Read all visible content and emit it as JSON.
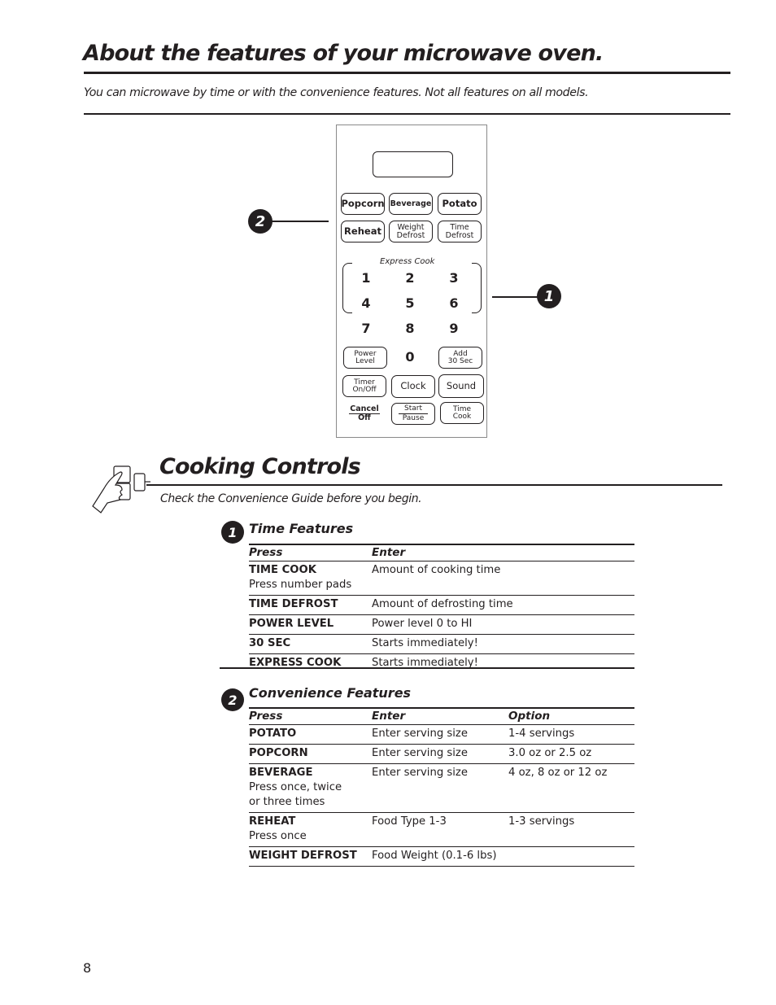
{
  "header": {
    "title": "About the features of your microwave oven.",
    "intro": "You can microwave by time or with the convenience features.  Not all features on all models."
  },
  "control_panel": {
    "row1": [
      "Popcorn",
      "Beverage",
      "Potato"
    ],
    "row2": [
      "Reheat",
      "Weight\nDefrost",
      "Time\nDefrost"
    ],
    "express_cook_label": "Express Cook",
    "numbers": [
      "1",
      "2",
      "3",
      "4",
      "5",
      "6",
      "7",
      "8",
      "9",
      "0"
    ],
    "power_level": "Power\nLevel",
    "add_30_sec": "Add\n30 Sec",
    "timer": "Timer\nOn/Off",
    "clock": "Clock",
    "sound": "Sound",
    "cancel_top": "Cancel",
    "cancel_bottom": "Off",
    "start_top": "Start",
    "start_bottom": "Pause",
    "time_cook": "Time\nCook",
    "callout_1": "1",
    "callout_2": "2"
  },
  "cooking_controls": {
    "title": "Cooking Controls",
    "subtitle": "Check the Convenience Guide before you begin.",
    "time_features": {
      "number": "1",
      "title": "Time Features",
      "columns": [
        "Press",
        "Enter"
      ],
      "rows": [
        {
          "press": "TIME COOK",
          "press_note": "Press number pads",
          "enter": "Amount of cooking time"
        },
        {
          "press": "TIME DEFROST",
          "press_note": "",
          "enter": "Amount of defrosting time"
        },
        {
          "press": "POWER LEVEL",
          "press_note": "",
          "enter": "Power level 0 to HI"
        },
        {
          "press": "30 SEC",
          "press_note": "",
          "enter": "Starts immediately!"
        },
        {
          "press": "EXPRESS COOK",
          "press_note": "",
          "enter": "Starts immediately!"
        }
      ]
    },
    "convenience_features": {
      "number": "2",
      "title": "Convenience Features",
      "columns": [
        "Press",
        "Enter",
        "Option"
      ],
      "rows": [
        {
          "press": "POTATO",
          "press_note": "",
          "enter": "Enter serving size",
          "option": "1-4 servings"
        },
        {
          "press": "POPCORN",
          "press_note": "",
          "enter": "Enter serving size",
          "option": "3.0 oz  or 2.5 oz"
        },
        {
          "press": "BEVERAGE",
          "press_note": "Press once, twice\nor three times",
          "enter": "Enter serving size",
          "option": "4 oz,  8 oz or 12 oz"
        },
        {
          "press": "REHEAT",
          "press_note": "Press once",
          "enter": "Food Type 1-3",
          "option": "1-3 servings"
        },
        {
          "press": "WEIGHT DEFROST",
          "press_note": "",
          "enter": "Food Weight  (0.1-6 lbs)",
          "option": ""
        }
      ]
    }
  },
  "footer": {
    "page_number": "8"
  }
}
